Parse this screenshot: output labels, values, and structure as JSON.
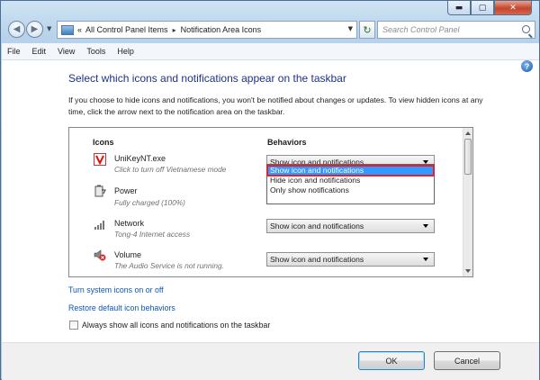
{
  "window": {
    "caption_buttons": {
      "minimize": "▬",
      "maximize": "▢",
      "close": "✕"
    }
  },
  "nav": {
    "back_icon": "◀",
    "forward_icon": "▶",
    "history_dropdown_icon": "▼",
    "breadcrumb": [
      "All Control Panel Items",
      "Notification Area Icons"
    ],
    "breadcrumb_prefix": "«",
    "breadcrumb_sep": "▸",
    "address_dropdown_icon": "▼",
    "refresh_icon": "↻",
    "search_placeholder": "Search Control Panel"
  },
  "menu": [
    "File",
    "Edit",
    "View",
    "Tools",
    "Help"
  ],
  "help_icon": "?",
  "heading": "Select which icons and notifications appear on the taskbar",
  "description": "If you choose to hide icons and notifications, you won't be notified about changes or updates. To view hidden icons at any time, click the arrow next to the notification area on the taskbar.",
  "table": {
    "col_icons": "Icons",
    "col_behaviors": "Behaviors",
    "rows": [
      {
        "name": "UniKeyNT.exe",
        "sub": "Click to turn off Vietnamese mode",
        "behavior": "Show icon and notifications",
        "icon": "unikey-icon"
      },
      {
        "name": "Power",
        "sub": "Fully charged (100%)",
        "behavior": "",
        "icon": "power-icon"
      },
      {
        "name": "Network",
        "sub": "Tong-4 Internet access",
        "behavior": "Show icon and notifications",
        "icon": "network-icon"
      },
      {
        "name": "Volume",
        "sub": "The Audio Service is not running.",
        "behavior": "Show icon and notifications",
        "icon": "volume-icon"
      }
    ],
    "dropdown_options": [
      "Show icon and notifications",
      "Hide icon and notifications",
      "Only show notifications"
    ],
    "dropdown_selected": "Show icon and notifications"
  },
  "links": {
    "system_icons": "Turn system icons on or off",
    "restore": "Restore default icon behaviors"
  },
  "checkbox_label": "Always show all icons and notifications on the taskbar",
  "checkbox_checked": false,
  "buttons": {
    "ok": "OK",
    "cancel": "Cancel"
  },
  "colors": {
    "heading": "#1e3287",
    "link": "#0b56b1",
    "selection": "#3399ff",
    "highlight_border": "#e0202e"
  }
}
